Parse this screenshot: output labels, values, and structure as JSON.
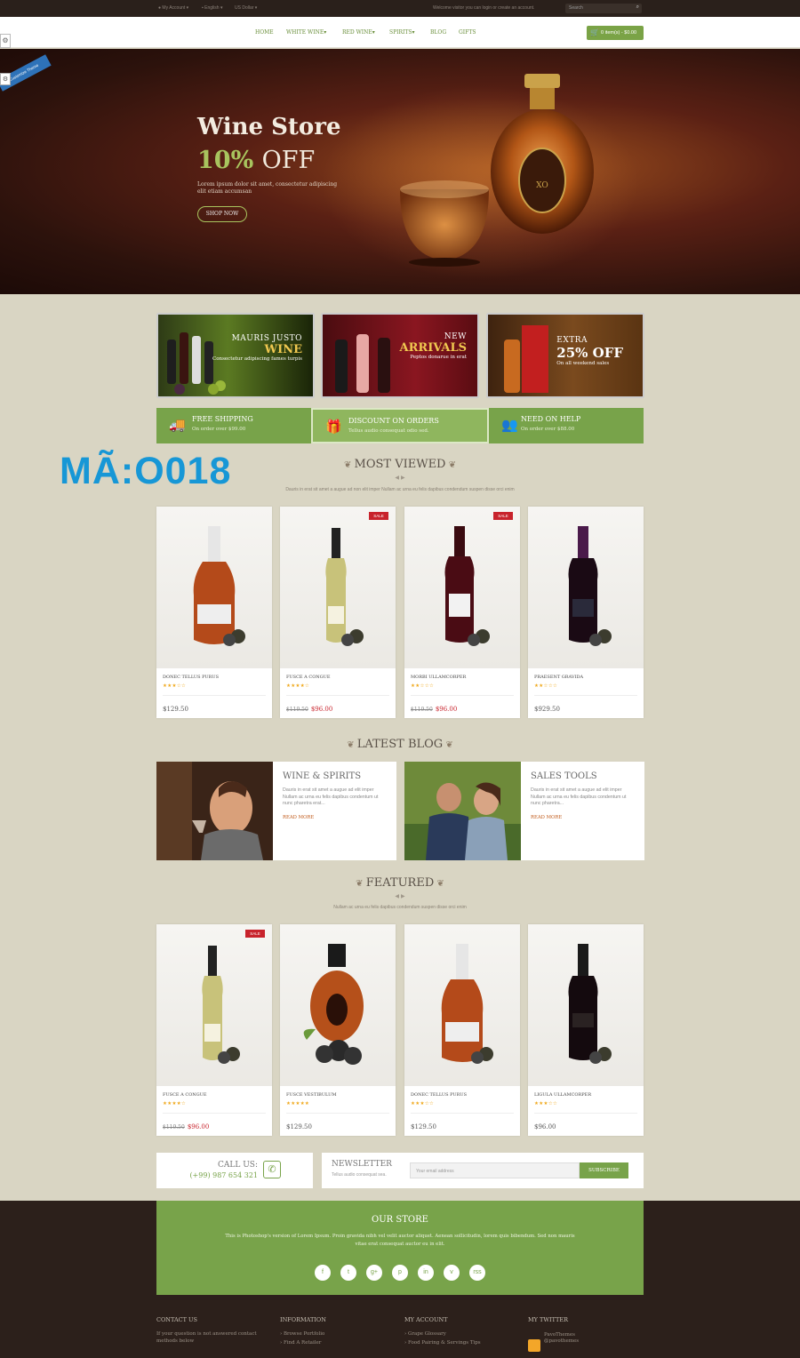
{
  "topbar": {
    "account": "My Account",
    "language": "English",
    "currency": "US Dollar",
    "welcome": "Welcome visitor you can login or create an account.",
    "search_placeholder": "Search"
  },
  "nav": {
    "items": [
      "HOME",
      "WHITE WINE",
      "RED WINE",
      "SPIRITS",
      "BLOG",
      "GIFTS"
    ],
    "cart": "0 item(s) - $0.00"
  },
  "hero": {
    "title": "Wine Store",
    "discount": "10%",
    "off": "OFF",
    "desc": "Lorem ipsum dolor sit amet, consectetur adipiscing elit etiam accumsan",
    "button": "SHOP NOW",
    "ribbon": "Customize Theme"
  },
  "promos": [
    {
      "l1": "MAURIS JUSTO",
      "l2": "WINE",
      "l3": "Consectetur adipiscing fames turpis"
    },
    {
      "l1": "NEW",
      "l2": "ARRIVALS",
      "l3": "Peptos donarue in erat"
    },
    {
      "l1": "EXTRA",
      "l2": "25% OFF",
      "l3": "On all weekend sales"
    }
  ],
  "services": [
    {
      "title": "FREE SHIPPING",
      "desc": "On order over $99.00"
    },
    {
      "title": "DISCOUNT ON ORDERS",
      "desc": "Tellus audio consequat odio sed."
    },
    {
      "title": "NEED ON HELP",
      "desc": "On order over $88.00"
    }
  ],
  "code_label": "MÃ:O018",
  "most_viewed": {
    "title": "MOST VIEWED",
    "desc": "Dauris in erat sit amet a augue ad non elit imper Nullam ac urna eu felis dapibus condendum suspen disse orci enim",
    "products": [
      {
        "name": "DONEC TELLUS PURUS",
        "stars": "★★★☆☆",
        "old": "",
        "price": "$129.50",
        "sale": ""
      },
      {
        "name": "FUSCE A CONGUE",
        "stars": "★★★★☆",
        "old": "$119.50",
        "price": "$96.00",
        "sale": "SALE"
      },
      {
        "name": "MORBI ULLAMCORPER",
        "stars": "★★☆☆☆",
        "old": "$119.50",
        "price": "$96.00",
        "sale": "SALE"
      },
      {
        "name": "PRAESENT GRAVIDA",
        "stars": "★★☆☆☆",
        "old": "",
        "price": "$929.50",
        "sale": ""
      }
    ]
  },
  "latest_blog": {
    "title": "LATEST BLOG",
    "posts": [
      {
        "title": "WINE & SPIRITS",
        "desc": "Dauris in erat sit amet a augue ad elit imper Nullam ac urna eu felis dapibus condentum ut nunc pharetra erat...",
        "more": "READ MORE"
      },
      {
        "title": "SALES TOOLS",
        "desc": "Dauris in erat sit amet a augue ad elit imper Nullam ac urna eu felis dapibus condentum ut nunc pharetra...",
        "more": "READ MORE"
      }
    ]
  },
  "featured": {
    "title": "FEATURED",
    "desc": "Nullam ac urna eu felis dapibus condendum suspen disse orci enim",
    "products": [
      {
        "name": "FUSCE A CONGUE",
        "stars": "★★★★☆",
        "old": "$119.50",
        "price": "$96.00",
        "sale": "SALE"
      },
      {
        "name": "FUSCE VESTIBULUM",
        "stars": "★★★★★",
        "old": "",
        "price": "$129.50",
        "sale": ""
      },
      {
        "name": "DONEC TELLUS PURUS",
        "stars": "★★★☆☆",
        "old": "",
        "price": "$129.50",
        "sale": ""
      },
      {
        "name": "LIGULA ULLAMCORPER",
        "stars": "★★★☆☆",
        "old": "",
        "price": "$96.00",
        "sale": ""
      }
    ]
  },
  "contact": {
    "call_label": "CALL US:",
    "phone": "(+99) 987 654 321"
  },
  "newsletter": {
    "title": "NEWSLETTER",
    "desc": "Tellus audio consequat sea.",
    "placeholder": "Your email address",
    "button": "SUBSCRIBE"
  },
  "footer": {
    "store_title": "OUR STORE",
    "store_desc": "This is Photoshop's version of Lorem Ipsum. Proin gravida nibh vel velit auctor aliquet. Aenean sollicitudin, lorem quis bibendum. Sed non mauris vitae erat consequat auctor eu in elit.",
    "social": [
      "f",
      "t",
      "g+",
      "p",
      "in",
      "v",
      "rss"
    ],
    "columns": [
      {
        "heading": "CONTACT US",
        "items": [
          "If your question is not answered contact methods below"
        ]
      },
      {
        "heading": "INFORMATION",
        "items": [
          "Browse Portfolio",
          "Find A Retailer"
        ]
      },
      {
        "heading": "MY ACCOUNT",
        "items": [
          "Grape Glossary",
          "Food Pairing & Servings Tips"
        ]
      },
      {
        "heading": "MY TWITTER",
        "items": [
          "PavoThemes",
          "@pavothemes"
        ]
      }
    ]
  }
}
